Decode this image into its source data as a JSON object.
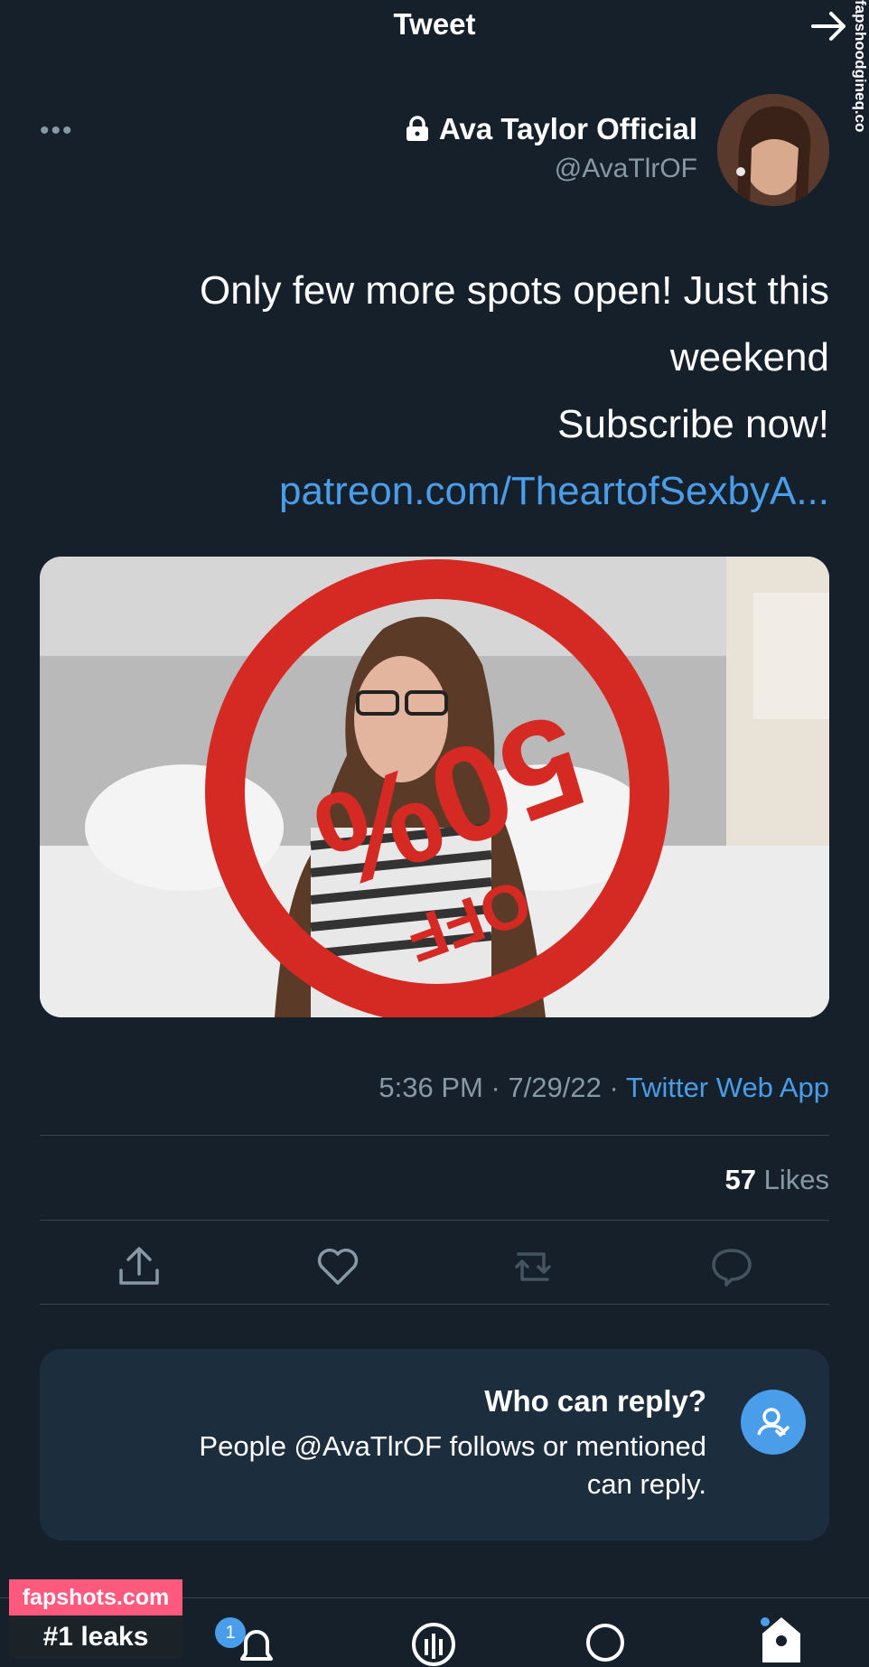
{
  "header": {
    "title": "Tweet",
    "watermark": "fapshoodgineq.co"
  },
  "tweet": {
    "display_name": "Ava Taylor Official",
    "handle": "@AvaTlrOF",
    "text_lines": [
      "Only few more spots open! Just this",
      "weekend",
      "Subscribe now!"
    ],
    "link": "patreon.com/TheartofSexbyA...",
    "time_date": "5:36 PM · 7/29/22 · ",
    "source": "Twitter Web App",
    "likes_count": "57",
    "likes_label": " Likes",
    "media_stamp_text": "50%",
    "media_stamp_off": "OFF"
  },
  "reply_card": {
    "title": "Who can reply?",
    "desc": "People @AvaTlrOF follows or mentioned can reply."
  },
  "bottom": {
    "notif_count": "1"
  },
  "watermark_badge": {
    "top": "fapshots.com",
    "bottom": "#1 leaks"
  },
  "icons": [
    "back-arrow-icon",
    "more-icon",
    "lock-icon",
    "share-icon",
    "like-icon",
    "retweet-icon",
    "reply-icon",
    "who-can-reply-icon",
    "home-icon",
    "search-icon",
    "spaces-icon",
    "notifications-icon",
    "messages-icon"
  ],
  "colors": {
    "background": "#15202b",
    "accent": "#4a9de8",
    "muted": "#8899a6",
    "card": "#1c2d3e",
    "badge_pink": "#ff5a7e"
  }
}
